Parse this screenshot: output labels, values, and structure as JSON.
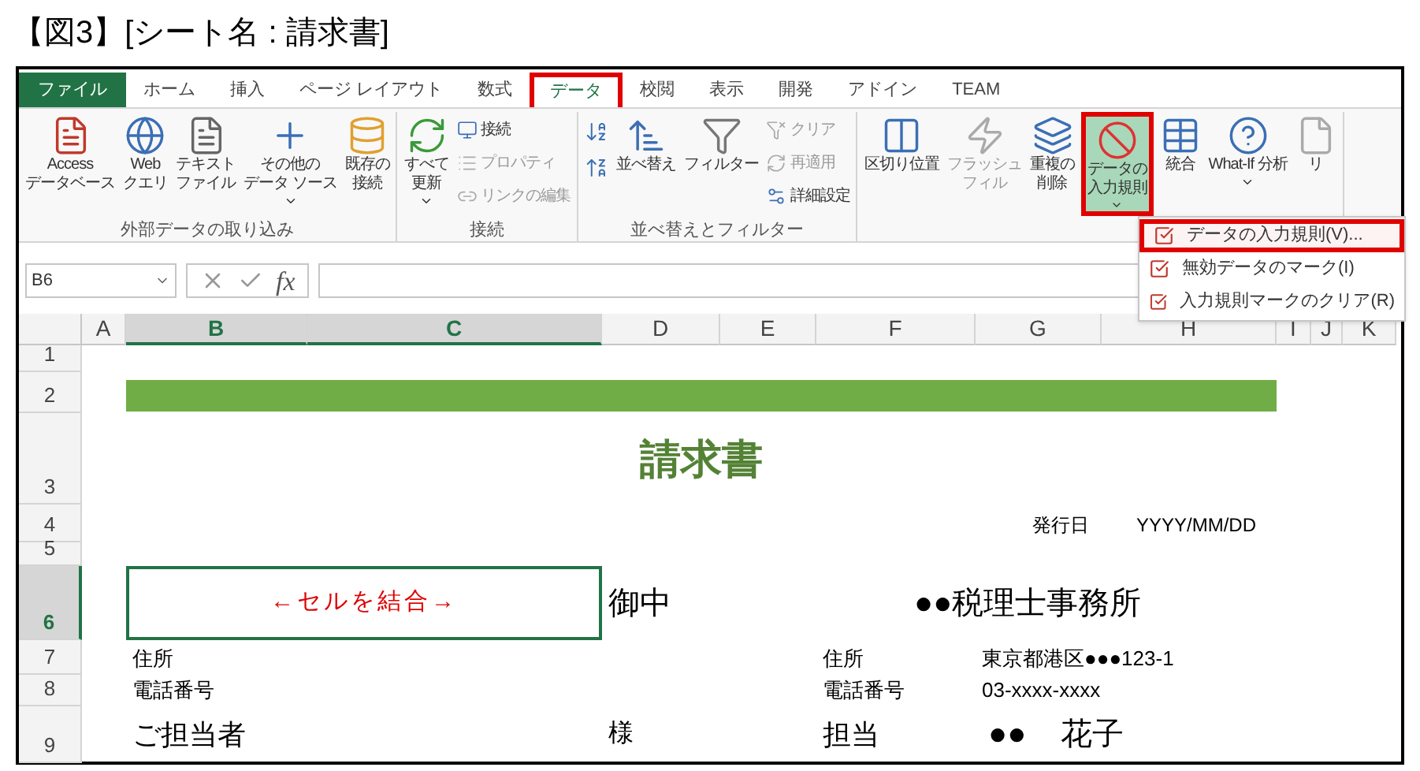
{
  "caption": "【図3】[シート名 : 請求書]",
  "tabs": [
    {
      "label": "ファイル",
      "kind": "file",
      "selected": false,
      "highlighted": false
    },
    {
      "label": "ホーム",
      "kind": "tab",
      "selected": false,
      "highlighted": false
    },
    {
      "label": "挿入",
      "kind": "tab",
      "selected": false,
      "highlighted": false
    },
    {
      "label": "ページ レイアウト",
      "kind": "tab",
      "selected": false,
      "highlighted": false
    },
    {
      "label": "数式",
      "kind": "tab",
      "selected": false,
      "highlighted": false
    },
    {
      "label": "データ",
      "kind": "tab",
      "selected": true,
      "highlighted": true
    },
    {
      "label": "校閲",
      "kind": "tab",
      "selected": false,
      "highlighted": false
    },
    {
      "label": "表示",
      "kind": "tab",
      "selected": false,
      "highlighted": false
    },
    {
      "label": "開発",
      "kind": "tab",
      "selected": false,
      "highlighted": false
    },
    {
      "label": "アドイン",
      "kind": "tab",
      "selected": false,
      "highlighted": false
    },
    {
      "label": "TEAM",
      "kind": "tab",
      "selected": false,
      "highlighted": false
    }
  ],
  "ribbon_groups": [
    {
      "label": "外部データの取り込み",
      "buttons": [
        {
          "kind": "large",
          "lines": [
            "Access",
            "データベース"
          ],
          "disabled": false,
          "dropdown": false,
          "selected": false,
          "highlighted": false
        },
        {
          "kind": "large",
          "lines": [
            "Web",
            "クエリ"
          ],
          "disabled": false,
          "dropdown": false,
          "selected": false,
          "highlighted": false
        },
        {
          "kind": "large",
          "lines": [
            "テキスト",
            "ファイル"
          ],
          "disabled": false,
          "dropdown": false,
          "selected": false,
          "highlighted": false
        },
        {
          "kind": "large",
          "lines": [
            "その他の",
            "データ ソース"
          ],
          "disabled": false,
          "dropdown": true,
          "selected": false,
          "highlighted": false
        },
        {
          "kind": "large",
          "lines": [
            "既存の",
            "接続"
          ],
          "disabled": false,
          "dropdown": false,
          "selected": false,
          "highlighted": false
        }
      ]
    },
    {
      "label": "接続",
      "buttons": [
        {
          "kind": "large",
          "lines": [
            "すべて",
            "更新"
          ],
          "disabled": false,
          "dropdown": true,
          "selected": false,
          "highlighted": false
        },
        {
          "kind": "small",
          "lines": [
            "接続"
          ],
          "disabled": false,
          "dropdown": false,
          "selected": false,
          "highlighted": false
        },
        {
          "kind": "small",
          "lines": [
            "プロパティ"
          ],
          "disabled": true,
          "dropdown": false,
          "selected": false,
          "highlighted": false
        },
        {
          "kind": "small",
          "lines": [
            "リンクの編集"
          ],
          "disabled": true,
          "dropdown": false,
          "selected": false,
          "highlighted": false
        }
      ]
    },
    {
      "label": "並べ替えとフィルター",
      "buttons": [
        {
          "kind": "icon",
          "disabled": false,
          "dropdown": false,
          "selected": false,
          "highlighted": false
        },
        {
          "kind": "icon",
          "disabled": false,
          "dropdown": false,
          "selected": false,
          "highlighted": false
        },
        {
          "kind": "large",
          "lines": [
            "並べ替え"
          ],
          "disabled": false,
          "dropdown": false,
          "selected": false,
          "highlighted": false
        },
        {
          "kind": "large",
          "lines": [
            "フィルター"
          ],
          "disabled": false,
          "dropdown": false,
          "selected": false,
          "highlighted": false
        },
        {
          "kind": "small",
          "lines": [
            "クリア"
          ],
          "disabled": true,
          "dropdown": false,
          "selected": false,
          "highlighted": false
        },
        {
          "kind": "small",
          "lines": [
            "再適用"
          ],
          "disabled": true,
          "dropdown": false,
          "selected": false,
          "highlighted": false
        },
        {
          "kind": "small",
          "lines": [
            "詳細設定"
          ],
          "disabled": false,
          "dropdown": false,
          "selected": false,
          "highlighted": false
        }
      ]
    },
    {
      "buttons": [
        {
          "kind": "large",
          "lines": [
            "区切り位置"
          ],
          "disabled": false,
          "dropdown": false,
          "selected": false,
          "highlighted": false
        },
        {
          "kind": "large",
          "lines": [
            "フラッシュ",
            "フィル"
          ],
          "disabled": true,
          "dropdown": false,
          "selected": false,
          "highlighted": false
        },
        {
          "kind": "large",
          "lines": [
            "重複の",
            "削除"
          ],
          "disabled": false,
          "dropdown": false,
          "selected": false,
          "highlighted": false
        },
        {
          "kind": "large",
          "lines": [
            "データの",
            "入力規則"
          ],
          "disabled": false,
          "dropdown": true,
          "selected": true,
          "highlighted": true
        },
        {
          "kind": "large",
          "lines": [
            "統合"
          ],
          "disabled": false,
          "dropdown": false,
          "selected": false,
          "highlighted": false
        },
        {
          "kind": "large",
          "lines": [
            "What-If 分析"
          ],
          "disabled": false,
          "dropdown": true,
          "selected": false,
          "highlighted": false
        },
        {
          "kind": "large",
          "lines": [
            "リ"
          ],
          "disabled": false,
          "dropdown": false,
          "selected": false,
          "highlighted": false
        }
      ]
    }
  ],
  "menu": [
    {
      "label": "データの入力規則(V)...",
      "highlighted": true
    },
    {
      "label": "無効データのマーク(I)",
      "highlighted": false
    },
    {
      "label": "入力規則マークのクリア(R)",
      "highlighted": false
    }
  ],
  "formula_bar": {
    "name_box": "B6",
    "function_button": "fx"
  },
  "columns": [
    {
      "label": "A",
      "selected": false
    },
    {
      "label": "B",
      "selected": true
    },
    {
      "label": "C",
      "selected": true
    },
    {
      "label": "D",
      "selected": false
    },
    {
      "label": "E",
      "selected": false
    },
    {
      "label": "F",
      "selected": false
    },
    {
      "label": "G",
      "selected": false
    },
    {
      "label": "H",
      "selected": false
    },
    {
      "label": "I",
      "selected": false
    },
    {
      "label": "J",
      "selected": false
    },
    {
      "label": "K",
      "selected": false
    }
  ],
  "rows": [
    {
      "number": "1",
      "selected": false
    },
    {
      "number": "2",
      "selected": false
    },
    {
      "number": "3",
      "selected": false
    },
    {
      "number": "4",
      "selected": false
    },
    {
      "number": "5",
      "selected": false
    },
    {
      "number": "6",
      "selected": true
    },
    {
      "number": "7",
      "selected": false
    },
    {
      "number": "8",
      "selected": false
    },
    {
      "number": "9",
      "selected": false
    }
  ],
  "invoice": {
    "title": "請求書",
    "issue_date": {
      "label": "発行日",
      "value": "YYYY/MM/DD"
    },
    "merged_cell": {
      "text": "←セルを結合→",
      "selected": true
    },
    "honorific": "御中",
    "issuer": "●●税理士事務所",
    "client_fields": [
      "住所",
      "電話番号"
    ],
    "issuer_fields": [
      {
        "label": "住所",
        "value": "東京都港区●●●123-1"
      },
      {
        "label": "電話番号",
        "value": "03-xxxx-xxxx"
      }
    ],
    "contact": {
      "label": "ご担当者",
      "suffix": "様"
    },
    "staff": {
      "label": "担当",
      "surname": "●●",
      "given_name": "花子"
    }
  }
}
